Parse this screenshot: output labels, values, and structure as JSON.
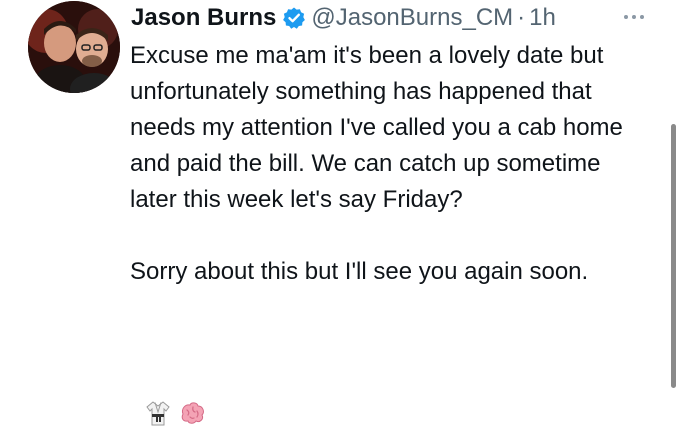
{
  "tweet": {
    "author_name": "Jason Burns",
    "handle": "@JasonBurns_CM",
    "separator": "·",
    "time": "1h",
    "body": [
      "Excuse me ma'am it's been a lovely date but unfortunately something has happened that needs my attention I've called you a cab home and paid the bill. We can catch up sometime later this week let's say Friday?",
      "Sorry about this but I'll see you again soon."
    ],
    "emojis": [
      "martial-arts-uniform-emoji",
      "brain-emoji"
    ]
  },
  "colors": {
    "text": "#0f1419",
    "secondary": "#536471",
    "verified": "#1d9bf0",
    "scrollbar": "#8a8a8a"
  }
}
